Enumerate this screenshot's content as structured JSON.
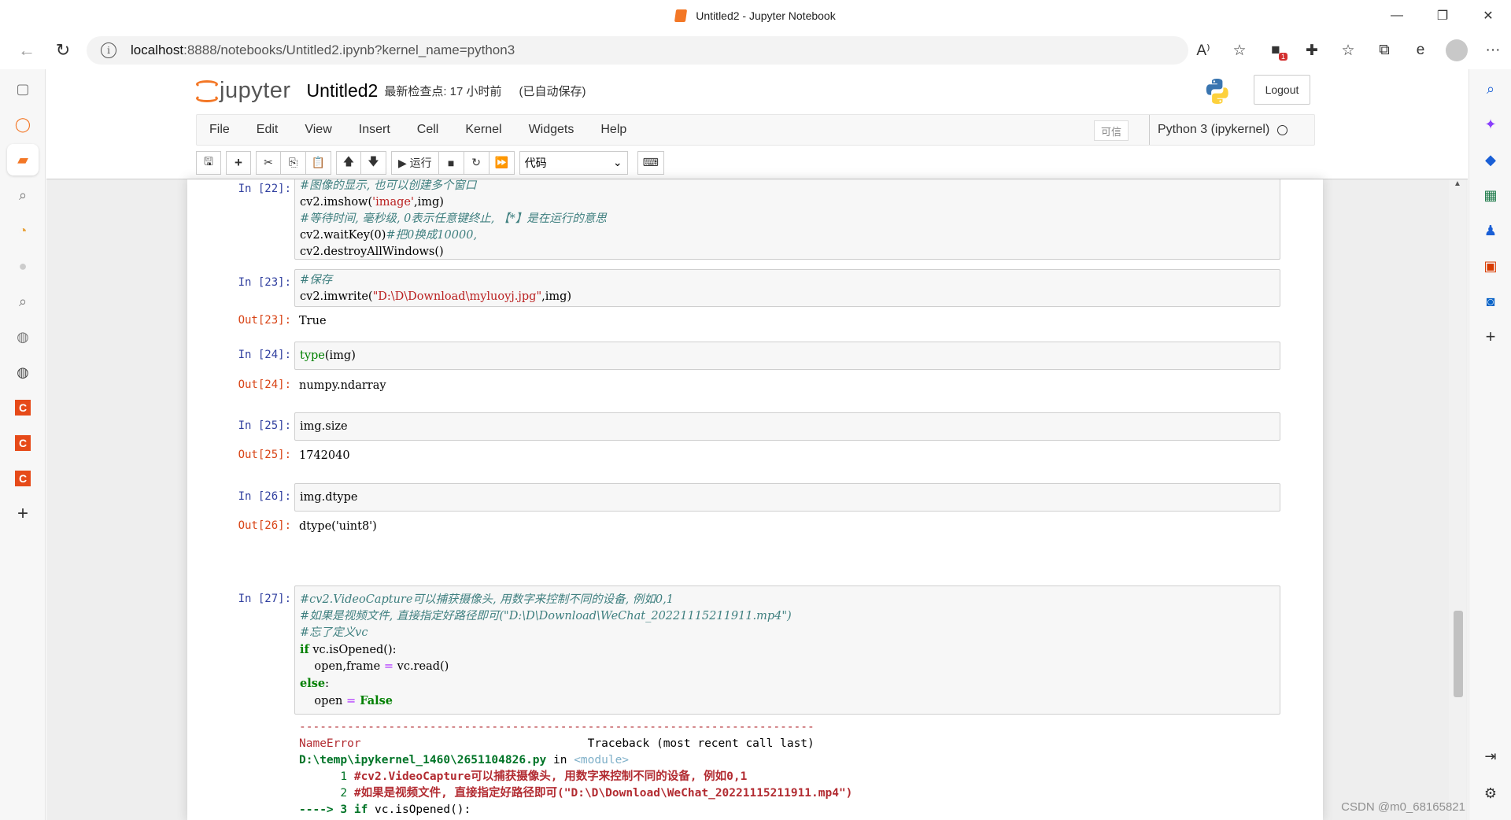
{
  "window": {
    "title": "Untitled2 - Jupyter Notebook",
    "controls": [
      "—",
      "❐",
      "✕"
    ]
  },
  "browser": {
    "back_icon": "←",
    "refresh_icon": "↻",
    "url_host": "localhost",
    "url_rest": ":8888/notebooks/Untitled2.ipynb?kernel_name=python3",
    "info_icon": "i",
    "tools": [
      "A⁾",
      "☆",
      "⧉",
      "✚",
      "☆",
      "⧉",
      "e",
      "",
      "···"
    ],
    "extension_badge": "1"
  },
  "left_rail": {
    "icons": [
      "▢",
      "◯",
      "▰",
      "⌕",
      "◔",
      "●",
      "⌕",
      "◍",
      "◍",
      "C",
      "C",
      "C",
      "+"
    ]
  },
  "right_rail": {
    "icons": [
      "⌕",
      "✦",
      "◆",
      "▦",
      "♟",
      "▣",
      "◙",
      "+"
    ],
    "bottom_icons": [
      "⇥",
      "⚙"
    ]
  },
  "notebook": {
    "logo_text": "jupyter",
    "name": "Untitled2",
    "checkpoint": "最新检查点: 17 小时前",
    "autosave": "(已自动保存)",
    "logout": "Logout",
    "menu": [
      "File",
      "Edit",
      "View",
      "Insert",
      "Cell",
      "Kernel",
      "Widgets",
      "Help"
    ],
    "trusted": "可信",
    "kernel": "Python 3 (ipykernel)",
    "toolbar": {
      "save": "🖫",
      "add": "+",
      "cut": "✂",
      "copy": "⎘",
      "paste": "📋",
      "up": "🡅",
      "down": "🡇",
      "run": "▶ 运行",
      "stop": "■",
      "restart": "↻",
      "restart_run": "⏩",
      "cell_type": "代码",
      "keyboard": "⌨"
    }
  },
  "cells": [
    {
      "in_prompt": "In  [22]:",
      "out_prompt": ""
    },
    {
      "in_prompt": "In  [23]:",
      "out_prompt": "Out[23]:",
      "output": "True"
    },
    {
      "in_prompt": "In  [24]:",
      "out_prompt": "Out[24]:",
      "output": "numpy.ndarray"
    },
    {
      "in_prompt": "In  [25]:",
      "out_prompt": "Out[25]:",
      "output": "1742040"
    },
    {
      "in_prompt": "In  [26]:",
      "out_prompt": "Out[26]:",
      "output": "dtype('uint8')"
    },
    {
      "in_prompt": "In  [27]:",
      "out_prompt": ""
    }
  ],
  "code": {
    "c22": {
      "l1": "#图像的显示, 也可以创建多个窗口",
      "l2a": "cv2.imshow(",
      "l2s": "'image'",
      "l2b": ",img)",
      "l3": "#等待时间, 毫秒级, 0表示任意键终止, 【*】是在运行的意思",
      "l4a": "cv2.waitKey(0)",
      "l4c": "#把0换成10000,",
      "l5": "cv2.destroyAllWindows()"
    },
    "c23": {
      "l1": "#保存",
      "l2a": "cv2.imwrite(",
      "l2s": "\"D:\\D\\Download\\myluoyj.jpg\"",
      "l2b": ",img)"
    },
    "c24": {
      "l1a": "type",
      "l1b": "(img)"
    },
    "c25": {
      "l1": "img.size"
    },
    "c26": {
      "l1": "img.dtype"
    },
    "c27": {
      "l1": "#cv2.VideoCapture可以捕获摄像头, 用数字来控制不同的设备, 例如0,1",
      "l2": "#如果是视频文件, 直接指定好路径即可(\"D:\\D\\Download\\WeChat_20221115211911.mp4\")",
      "l3": "#忘了定义vc",
      "l4k": "if",
      "l4b": " vc.isOpened():",
      "l5a": "    open,frame ",
      "l5o": "=",
      "l5b": " vc.read()",
      "l6k": "else",
      "l6b": ":",
      "l7a": "    open ",
      "l7o": "=",
      "l7k": " False"
    }
  },
  "traceback": {
    "dashes": "---------------------------------------------------------------------------",
    "error_name": "NameError",
    "tb_title": "Traceback (most recent call last)",
    "file": "D:\\temp\\ipykernel_1460\\2651104826.py",
    "in": " in ",
    "module": "<module>",
    "line1_no": "      1 ",
    "line1": "#cv2.VideoCapture可以捕获摄像头, 用数字来控制不同的设备, 例如0,1",
    "line2_no": "      2 ",
    "line2": "#如果是视频文件, 直接指定好路径即可(\"D:\\D\\Download\\WeChat_20221115211911.mp4\")",
    "arrow": "----> 3 ",
    "line3k": "if",
    "line3": " vc.isOpened():"
  },
  "watermark": "CSDN @m0_68165821",
  "colors": {
    "jupyter_orange": "#f37726",
    "prompt_in": "#303f9f",
    "prompt_out": "#d84315",
    "comment": "#408080",
    "string": "#ba2121",
    "keyword": "#008000"
  }
}
